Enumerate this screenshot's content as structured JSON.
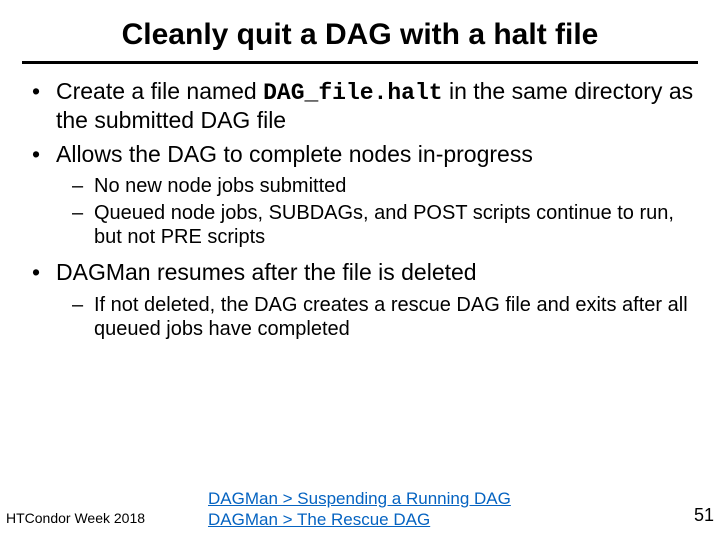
{
  "title": "Cleanly quit a DAG with a halt file",
  "bullets": {
    "b1_pre": "Create a file named ",
    "b1_code": "DAG_file.halt",
    "b1_post": " in the same directory as the submitted DAG file",
    "b2": "Allows the DAG to complete nodes in-progress",
    "b2_sub1": "No new node jobs submitted",
    "b2_sub2": "Queued node jobs, SUBDAGs, and POST scripts continue to run, but not PRE scripts",
    "b3": "DAGMan resumes after the file is deleted",
    "b3_sub1": "If not deleted, the DAG creates a rescue DAG file and exits after all queued jobs have completed"
  },
  "footer": {
    "left": "HTCondor Week 2018",
    "link1": "DAGMan > Suspending a Running DAG",
    "link2": "DAGMan > The Rescue DAG",
    "page": "51"
  }
}
